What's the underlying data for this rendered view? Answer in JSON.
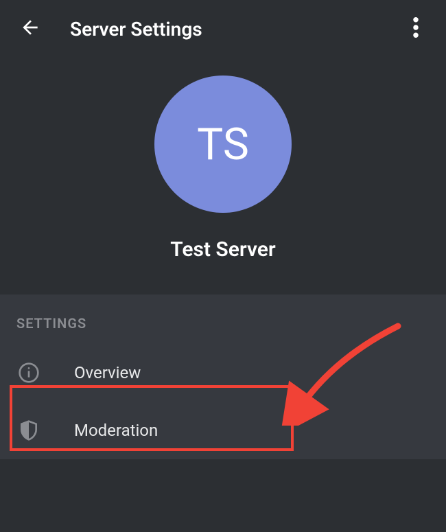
{
  "header": {
    "title": "Server Settings"
  },
  "server": {
    "avatar_initials": "TS",
    "name": "Test Server"
  },
  "settings": {
    "section_label": "SETTINGS",
    "items": [
      {
        "label": "Overview"
      },
      {
        "label": "Moderation"
      }
    ]
  }
}
